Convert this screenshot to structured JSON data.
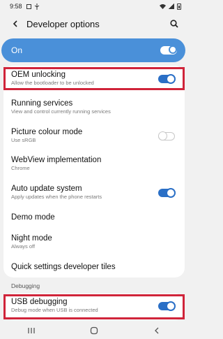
{
  "status_bar": {
    "time": "9:58"
  },
  "header": {
    "title": "Developer options"
  },
  "master": {
    "label": "On",
    "on": true
  },
  "items": [
    {
      "title": "OEM unlocking",
      "subtitle": "Allow the bootloader to be unlocked",
      "toggle": "on",
      "highlighted": true
    },
    {
      "title": "Running services",
      "subtitle": "View and control currently running services"
    },
    {
      "title": "Picture colour mode",
      "subtitle": "Use sRGB",
      "toggle": "off"
    },
    {
      "title": "WebView implementation",
      "subtitle": "Chrome"
    },
    {
      "title": "Auto update system",
      "subtitle": "Apply updates when the phone restarts",
      "toggle": "on"
    },
    {
      "title": "Demo mode"
    },
    {
      "title": "Night mode",
      "subtitle": "Always off"
    },
    {
      "title": "Quick settings developer tiles"
    }
  ],
  "debugging": {
    "section_label": "Debugging",
    "usb": {
      "title": "USB debugging",
      "subtitle": "Debug mode when USB is connected",
      "toggle": "on",
      "highlighted": true
    }
  },
  "colors": {
    "accent": "#2a6fc6",
    "master_bg": "#4a90d9",
    "highlight": "#d0243a",
    "background": "#f1f1f1"
  },
  "nav": {
    "icons": [
      "recents-icon",
      "home-icon",
      "back-nav-icon"
    ]
  }
}
